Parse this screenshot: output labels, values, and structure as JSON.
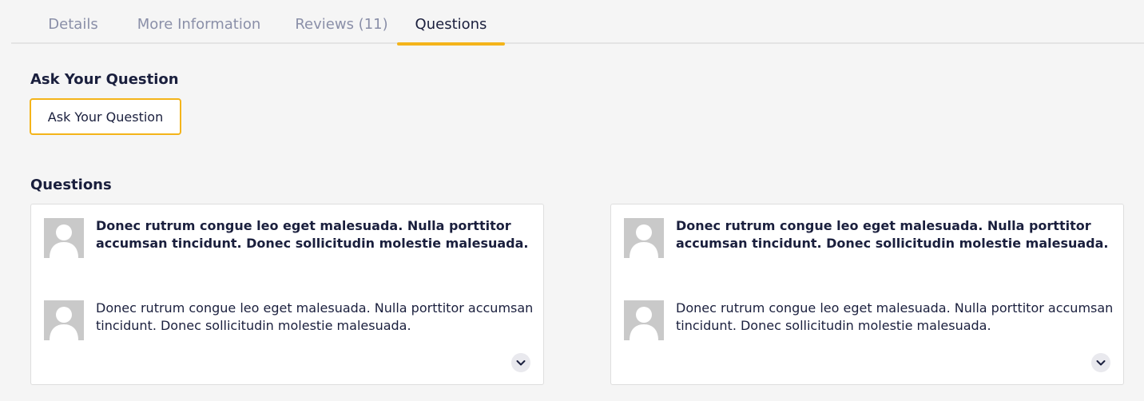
{
  "tabs": [
    {
      "label": "Details"
    },
    {
      "label": "More Information"
    },
    {
      "label": "Reviews (11)"
    },
    {
      "label": "Questions",
      "active": true
    }
  ],
  "ask": {
    "heading": "Ask Your Question",
    "button_label": "Ask Your Question"
  },
  "questions": {
    "heading": "Questions",
    "items": [
      {
        "question": "Donec rutrum congue leo eget malesuada. Nulla porttitor accumsan tincidunt. Donec sollicitudin molestie malesuada.",
        "answer": "Donec rutrum congue leo eget malesuada. Nulla porttitor accumsan tincidunt. Donec sollicitudin molestie malesuada.",
        "avatar_icon": "user-placeholder-icon",
        "expand_icon": "chevron-down-icon"
      },
      {
        "question": "Donec rutrum congue leo eget malesuada. Nulla porttitor accumsan tincidunt. Donec sollicitudin molestie malesuada.",
        "answer": "Donec rutrum congue leo eget malesuada. Nulla porttitor accumsan tincidunt. Donec sollicitudin molestie malesuada.",
        "avatar_icon": "user-placeholder-icon",
        "expand_icon": "chevron-down-icon"
      }
    ]
  },
  "colors": {
    "accent": "#f4b41a",
    "text_dark": "#1a1f3d",
    "text_muted": "#8a8fa8",
    "background": "#f5f5f5",
    "avatar_bg": "#c9c9c9"
  }
}
